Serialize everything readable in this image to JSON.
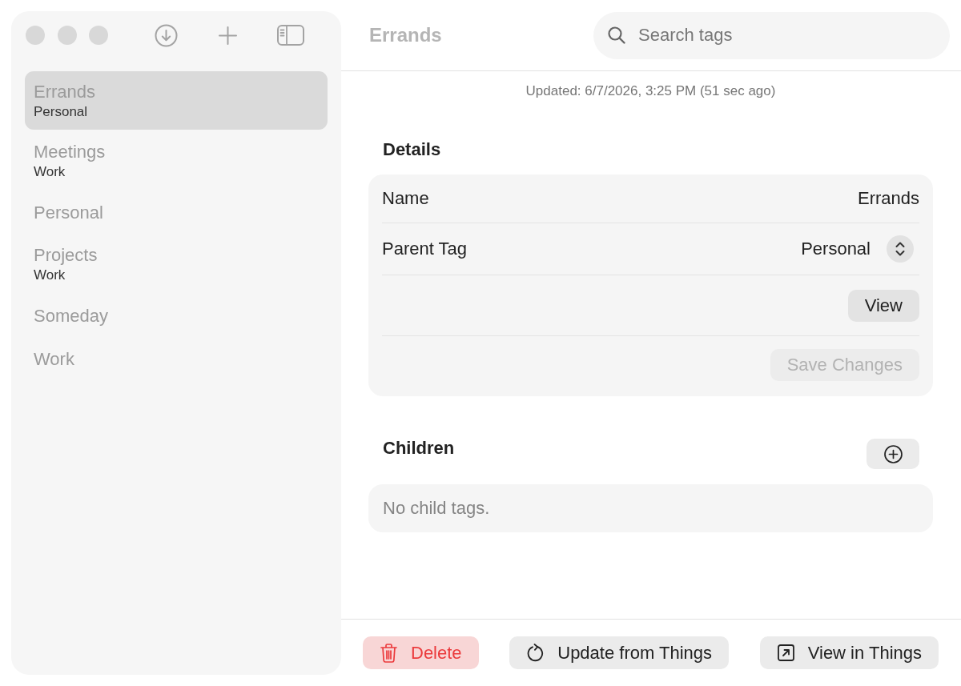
{
  "sidebar": {
    "items": [
      {
        "title": "Errands",
        "subtitle": "Personal",
        "selected": true
      },
      {
        "title": "Meetings",
        "subtitle": "Work",
        "selected": false
      },
      {
        "title": "Personal",
        "selected": false
      },
      {
        "title": "Projects",
        "subtitle": "Work",
        "selected": false
      },
      {
        "title": "Someday",
        "selected": false
      },
      {
        "title": "Work",
        "selected": false
      }
    ]
  },
  "header": {
    "title": "Errands"
  },
  "search": {
    "placeholder": "Search tags"
  },
  "updated": "Updated: 6/7/2026, 3:25 PM (51 sec ago)",
  "details": {
    "heading": "Details",
    "rows": [
      {
        "kind": "field",
        "label": "Name",
        "value": "Errands"
      },
      {
        "kind": "picker",
        "label": "Parent Tag",
        "value": "Personal"
      },
      {
        "kind": "button",
        "label": "View",
        "disabled": false
      },
      {
        "kind": "button",
        "label": "Save Changes",
        "disabled": true
      }
    ]
  },
  "children": {
    "heading": "Children",
    "empty_text": "No child tags."
  },
  "footer": {
    "buttons": [
      {
        "kind": "delete",
        "label": "Delete"
      },
      {
        "kind": "refresh",
        "label": "Update from Things"
      },
      {
        "kind": "open",
        "label": "View in Things"
      }
    ]
  }
}
